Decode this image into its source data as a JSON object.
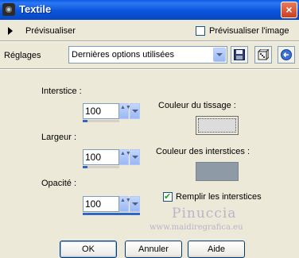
{
  "window": {
    "title": "Textile",
    "close_glyph": "×"
  },
  "preview": {
    "label": "Prévisualiser",
    "checkbox_label": "Prévisualiser l'image",
    "checked": false
  },
  "settings": {
    "label": "Réglages",
    "selected": "Dernières options utilisées",
    "icons": [
      "save-icon",
      "dice-icon",
      "reset-icon"
    ]
  },
  "fields": {
    "gap_label": "Interstice :",
    "gap_value": "100",
    "width_label": "Largeur :",
    "width_value": "100",
    "opacity_label": "Opacité :",
    "opacity_value": "100",
    "spin_glyph": "▲▼"
  },
  "colors": {
    "weave_label": "Couleur du tissage :",
    "weave_color": "#dcdcdc",
    "gap_color_label": "Couleur des interstices :",
    "gap_color": "#8e9aa6",
    "fill_label": "Remplir les interstices",
    "fill_checked": true
  },
  "watermark": {
    "name": "Pinuccia",
    "site": "www.maidiregrafica.eu"
  },
  "buttons": {
    "ok": "OK",
    "cancel": "Annuler",
    "help": "Aide"
  }
}
